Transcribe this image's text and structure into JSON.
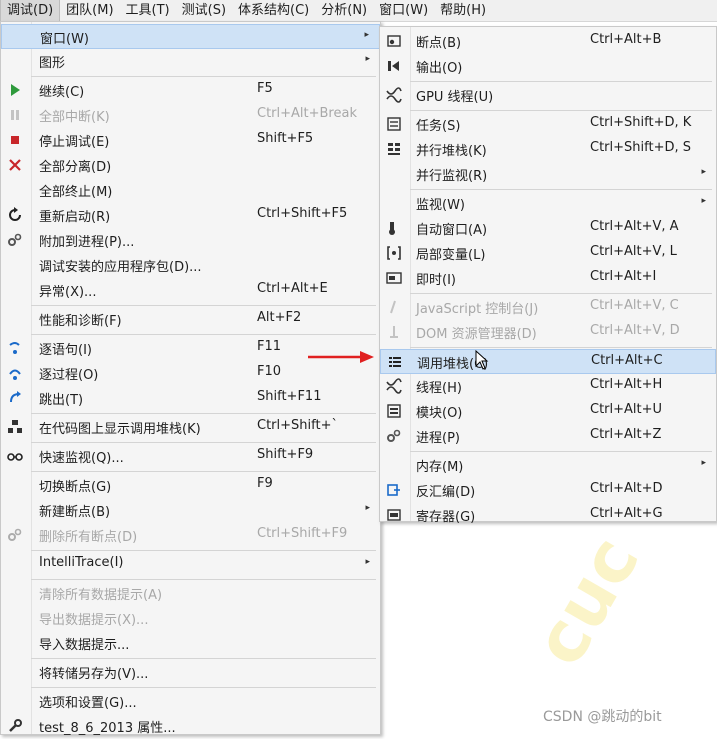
{
  "menubar": [
    "调试(D)",
    "团队(M)",
    "工具(T)",
    "测试(S)",
    "体系结构(C)",
    "分析(N)",
    "窗口(W)",
    "帮助(H)"
  ],
  "debug_menu": [
    {
      "label": "窗口(W)",
      "shortcut": "",
      "icon": "none",
      "submenu": true,
      "state": "highlighted"
    },
    {
      "label": "图形",
      "shortcut": "",
      "icon": "none",
      "submenu": true,
      "state": "normal"
    },
    {
      "sep": true
    },
    {
      "label": "继续(C)",
      "shortcut": "F5",
      "icon": "play-icon",
      "submenu": false,
      "state": "normal"
    },
    {
      "label": "全部中断(K)",
      "shortcut": "Ctrl+Alt+Break",
      "icon": "pause-icon",
      "submenu": false,
      "state": "disabled"
    },
    {
      "label": "停止调试(E)",
      "shortcut": "Shift+F5",
      "icon": "stop-icon",
      "submenu": false,
      "state": "normal"
    },
    {
      "label": "全部分离(D)",
      "shortcut": "",
      "icon": "close-icon",
      "submenu": false,
      "state": "normal"
    },
    {
      "label": "全部终止(M)",
      "shortcut": "",
      "icon": "none",
      "submenu": false,
      "state": "normal"
    },
    {
      "label": "重新启动(R)",
      "shortcut": "Ctrl+Shift+F5",
      "icon": "restart-icon",
      "submenu": false,
      "state": "normal"
    },
    {
      "label": "附加到进程(P)...",
      "shortcut": "",
      "icon": "gears-icon",
      "submenu": false,
      "state": "normal"
    },
    {
      "label": "调试安装的应用程序包(D)...",
      "shortcut": "",
      "icon": "none",
      "submenu": false,
      "state": "normal"
    },
    {
      "label": "异常(X)...",
      "shortcut": "Ctrl+Alt+E",
      "icon": "none",
      "submenu": false,
      "state": "normal"
    },
    {
      "sep": true
    },
    {
      "label": "性能和诊断(F)",
      "shortcut": "Alt+F2",
      "icon": "none",
      "submenu": false,
      "state": "normal"
    },
    {
      "sep": true
    },
    {
      "label": "逐语句(I)",
      "shortcut": "F11",
      "icon": "step-into-icon",
      "submenu": false,
      "state": "normal"
    },
    {
      "label": "逐过程(O)",
      "shortcut": "F10",
      "icon": "step-over-icon",
      "submenu": false,
      "state": "normal"
    },
    {
      "label": "跳出(T)",
      "shortcut": "Shift+F11",
      "icon": "step-out-icon",
      "submenu": false,
      "state": "normal"
    },
    {
      "sep": true
    },
    {
      "label": "在代码图上显示调用堆栈(K)",
      "shortcut": "Ctrl+Shift+`",
      "icon": "code-map-icon",
      "submenu": false,
      "state": "normal"
    },
    {
      "sep": true
    },
    {
      "label": "快速监视(Q)...",
      "shortcut": "Shift+F9",
      "icon": "glasses-icon",
      "submenu": false,
      "state": "normal"
    },
    {
      "sep": true
    },
    {
      "label": "切换断点(G)",
      "shortcut": "F9",
      "icon": "none",
      "submenu": false,
      "state": "normal"
    },
    {
      "label": "新建断点(B)",
      "shortcut": "",
      "icon": "none",
      "submenu": true,
      "state": "normal"
    },
    {
      "label": "删除所有断点(D)",
      "shortcut": "Ctrl+Shift+F9",
      "icon": "gears-icon",
      "submenu": false,
      "state": "disabled"
    },
    {
      "sep": true
    },
    {
      "label": "IntelliTrace(I)",
      "shortcut": "",
      "icon": "none",
      "submenu": true,
      "state": "normal"
    },
    {
      "sep": true
    },
    {
      "label": "清除所有数据提示(A)",
      "shortcut": "",
      "icon": "none",
      "submenu": false,
      "state": "disabled"
    },
    {
      "label": "导出数据提示(X)...",
      "shortcut": "",
      "icon": "none",
      "submenu": false,
      "state": "disabled"
    },
    {
      "label": "导入数据提示...",
      "shortcut": "",
      "icon": "none",
      "submenu": false,
      "state": "normal"
    },
    {
      "sep": true
    },
    {
      "label": "将转储另存为(V)...",
      "shortcut": "",
      "icon": "none",
      "submenu": false,
      "state": "normal"
    },
    {
      "sep": true
    },
    {
      "label": "选项和设置(G)...",
      "shortcut": "",
      "icon": "none",
      "submenu": false,
      "state": "normal"
    },
    {
      "label": "test_8_6_2013 属性...",
      "shortcut": "",
      "icon": "wrench-icon",
      "submenu": false,
      "state": "normal"
    }
  ],
  "window_submenu": [
    {
      "label": "断点(B)",
      "shortcut": "Ctrl+Alt+B",
      "icon": "breakpoints-window-icon",
      "submenu": false,
      "state": "normal"
    },
    {
      "label": "输出(O)",
      "shortcut": "",
      "icon": "output-icon",
      "submenu": false,
      "state": "normal"
    },
    {
      "sep": true
    },
    {
      "label": "GPU 线程(U)",
      "shortcut": "",
      "icon": "threads-icon",
      "submenu": false,
      "state": "normal"
    },
    {
      "sep": true
    },
    {
      "label": "任务(S)",
      "shortcut": "Ctrl+Shift+D, K",
      "icon": "tasks-icon",
      "submenu": false,
      "state": "normal"
    },
    {
      "label": "并行堆栈(K)",
      "shortcut": "Ctrl+Shift+D, S",
      "icon": "parallel-stacks-icon",
      "submenu": false,
      "state": "normal"
    },
    {
      "label": "并行监视(R)",
      "shortcut": "",
      "icon": "none",
      "submenu": true,
      "state": "normal"
    },
    {
      "sep": true
    },
    {
      "label": "监视(W)",
      "shortcut": "",
      "icon": "none",
      "submenu": true,
      "state": "normal"
    },
    {
      "label": "自动窗口(A)",
      "shortcut": "Ctrl+Alt+V, A",
      "icon": "autos-icon",
      "submenu": false,
      "state": "normal"
    },
    {
      "label": "局部变量(L)",
      "shortcut": "Ctrl+Alt+V, L",
      "icon": "locals-icon",
      "submenu": false,
      "state": "normal"
    },
    {
      "label": "即时(I)",
      "shortcut": "Ctrl+Alt+I",
      "icon": "immediate-icon",
      "submenu": false,
      "state": "normal"
    },
    {
      "sep": true
    },
    {
      "label": "JavaScript 控制台(J)",
      "shortcut": "Ctrl+Alt+V, C",
      "icon": "js-console-icon",
      "submenu": false,
      "state": "disabled"
    },
    {
      "label": "DOM 资源管理器(D)",
      "shortcut": "Ctrl+Alt+V, D",
      "icon": "dom-explorer-icon",
      "submenu": false,
      "state": "disabled"
    },
    {
      "sep": true
    },
    {
      "label": "调用堆栈(C)",
      "shortcut": "Ctrl+Alt+C",
      "icon": "call-stack-icon",
      "submenu": false,
      "state": "highlighted"
    },
    {
      "label": "线程(H)",
      "shortcut": "Ctrl+Alt+H",
      "icon": "threads-icon",
      "submenu": false,
      "state": "normal"
    },
    {
      "label": "模块(O)",
      "shortcut": "Ctrl+Alt+U",
      "icon": "modules-icon",
      "submenu": false,
      "state": "normal"
    },
    {
      "label": "进程(P)",
      "shortcut": "Ctrl+Alt+Z",
      "icon": "gears-icon",
      "submenu": false,
      "state": "normal"
    },
    {
      "sep": true
    },
    {
      "label": "内存(M)",
      "shortcut": "",
      "icon": "none",
      "submenu": true,
      "state": "normal"
    },
    {
      "label": "反汇编(D)",
      "shortcut": "Ctrl+Alt+D",
      "icon": "disassembly-icon",
      "submenu": false,
      "state": "normal"
    },
    {
      "label": "寄存器(G)",
      "shortcut": "Ctrl+Alt+G",
      "icon": "registers-icon",
      "submenu": false,
      "state": "normal"
    }
  ],
  "watermark": "CSDN @跳动的bit",
  "colors": {
    "highlight": "#cfe2f6",
    "highlight_border": "#a9c9ee",
    "disabled": "#a8a8a8",
    "annotation_arrow": "#e02020"
  }
}
